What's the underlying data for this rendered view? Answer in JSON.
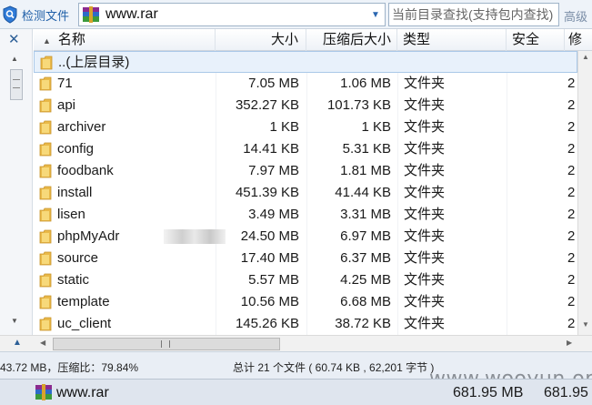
{
  "toolbar": {
    "detect_label": "检测文件",
    "path": "www.rar",
    "search_placeholder": "当前目录查找(支持包内查找)",
    "advanced_label": "高级"
  },
  "columns": {
    "name": "名称",
    "size": "大小",
    "packed": "压缩后大小",
    "type": "类型",
    "security": "安全",
    "modified": "修"
  },
  "parent_row": {
    "name": "..(上层目录)"
  },
  "rows": [
    {
      "name": "71",
      "size": "7.05 MB",
      "packed": "1.06 MB",
      "type": "文件夹",
      "mod": "2"
    },
    {
      "name": "api",
      "size": "352.27 KB",
      "packed": "101.73 KB",
      "type": "文件夹",
      "mod": "2"
    },
    {
      "name": "archiver",
      "size": "1 KB",
      "packed": "1 KB",
      "type": "文件夹",
      "mod": "2"
    },
    {
      "name": "config",
      "size": "14.41 KB",
      "packed": "5.31 KB",
      "type": "文件夹",
      "mod": "2"
    },
    {
      "name": "foodbank",
      "size": "7.97 MB",
      "packed": "1.81 MB",
      "type": "文件夹",
      "mod": "2"
    },
    {
      "name": "install",
      "size": "451.39 KB",
      "packed": "41.44 KB",
      "type": "文件夹",
      "mod": "2"
    },
    {
      "name": "lisen",
      "size": "3.49 MB",
      "packed": "3.31 MB",
      "type": "文件夹",
      "mod": "2"
    },
    {
      "name": "phpMyAdr",
      "size": "24.50 MB",
      "packed": "6.97 MB",
      "type": "文件夹",
      "mod": "2"
    },
    {
      "name": "source",
      "size": "17.40 MB",
      "packed": "6.37 MB",
      "type": "文件夹",
      "mod": "2"
    },
    {
      "name": "static",
      "size": "5.57 MB",
      "packed": "4.25 MB",
      "type": "文件夹",
      "mod": "2"
    },
    {
      "name": "template",
      "size": "10.56 MB",
      "packed": "6.68 MB",
      "type": "文件夹",
      "mod": "2"
    },
    {
      "name": "uc_client",
      "size": "145.26 KB",
      "packed": "38.72 KB",
      "type": "文件夹",
      "mod": "2"
    }
  ],
  "status": {
    "left": "43.72 MB，压缩比：79.84%",
    "right": "总计 21 个文件 ( 60.74 KB , 62,201 字节 )"
  },
  "watermark": "www.wooyun.org",
  "bottom_bar": {
    "name": "www.rar",
    "size1": "681.95 MB",
    "size2": "681.95"
  },
  "colors": {
    "accent": "#1f5fa8",
    "selected_row": "#e8f1fb",
    "folder": "#e9b949"
  }
}
